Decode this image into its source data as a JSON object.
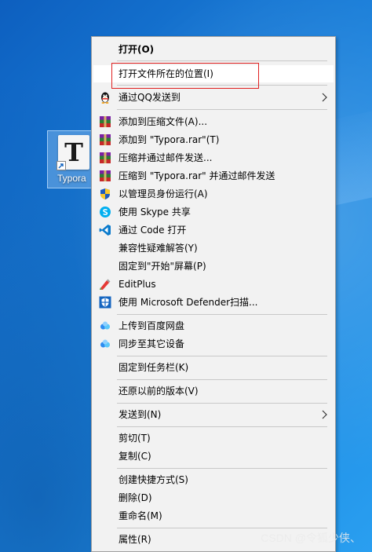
{
  "desktop": {
    "icon_label": "Typora",
    "icon_glyph": "T",
    "watermark": "CSDN @令狐少侠、"
  },
  "menu": {
    "items": [
      {
        "label": "打开(O)",
        "icon": "none",
        "bold": true
      },
      {
        "label": "打开文件所在的位置(I)",
        "icon": "none",
        "highlighted": true
      },
      {
        "label": "通过QQ发送到",
        "icon": "qq-penguin-icon",
        "submenu": true
      },
      {
        "label": "添加到压缩文件(A)...",
        "icon": "winrar-icon"
      },
      {
        "label": "添加到 \"Typora.rar\"(T)",
        "icon": "winrar-icon"
      },
      {
        "label": "压缩并通过邮件发送...",
        "icon": "winrar-icon"
      },
      {
        "label": "压缩到 \"Typora.rar\" 并通过邮件发送",
        "icon": "winrar-icon"
      },
      {
        "label": "以管理员身份运行(A)",
        "icon": "uac-shield-icon"
      },
      {
        "label": "使用 Skype 共享",
        "icon": "skype-icon"
      },
      {
        "label": "通过 Code 打开",
        "icon": "vscode-icon"
      },
      {
        "label": "兼容性疑难解答(Y)",
        "icon": "none"
      },
      {
        "label": "固定到\"开始\"屏幕(P)",
        "icon": "none"
      },
      {
        "label": "EditPlus",
        "icon": "editplus-icon"
      },
      {
        "label": "使用 Microsoft Defender扫描...",
        "icon": "defender-shield-icon"
      },
      {
        "label": "上传到百度网盘",
        "icon": "baidu-netdisk-icon"
      },
      {
        "label": "同步至其它设备",
        "icon": "baidu-netdisk-icon"
      },
      {
        "label": "固定到任务栏(K)",
        "icon": "none"
      },
      {
        "label": "还原以前的版本(V)",
        "icon": "none"
      },
      {
        "label": "发送到(N)",
        "icon": "none",
        "submenu": true
      },
      {
        "label": "剪切(T)",
        "icon": "none"
      },
      {
        "label": "复制(C)",
        "icon": "none"
      },
      {
        "label": "创建快捷方式(S)",
        "icon": "none"
      },
      {
        "label": "删除(D)",
        "icon": "none"
      },
      {
        "label": "重命名(M)",
        "icon": "none"
      },
      {
        "label": "属性(R)",
        "icon": "none"
      }
    ]
  },
  "colors": {
    "highlight_border": "#e02020",
    "menu_background": "#f2f2f2",
    "desktop_blue": "#1778d4"
  }
}
